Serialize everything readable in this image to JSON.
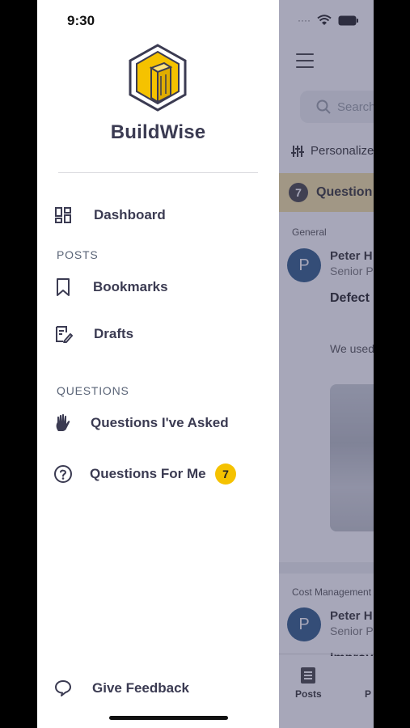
{
  "status_bar": {
    "time": "9:30"
  },
  "brand": {
    "name": "BuildWise",
    "logo_icon": "buildwise-hexagon-logo"
  },
  "drawer": {
    "dashboard": {
      "label": "Dashboard",
      "icon": "dashboard-icon"
    },
    "posts_section": "POSTS",
    "bookmarks": {
      "label": "Bookmarks",
      "icon": "bookmark-icon"
    },
    "drafts": {
      "label": "Drafts",
      "icon": "drafts-icon"
    },
    "questions_section": "QUESTIONS",
    "questions_asked": {
      "label": "Questions I've Asked",
      "icon": "raised-hand-icon"
    },
    "questions_for_me": {
      "label": "Questions For Me",
      "icon": "question-circle-icon",
      "badge": "7"
    },
    "feedback": {
      "label": "Give Feedback",
      "icon": "chat-bubble-icon"
    }
  },
  "background": {
    "search_placeholder": "Search",
    "personalize_label": "Personalize",
    "questions_banner": {
      "count": "7",
      "label": "Question"
    },
    "section_general": "General",
    "post1": {
      "avatar": "P",
      "name": "Peter H",
      "role": "Senior P",
      "title": "Defect project",
      "text": "We used project"
    },
    "section_cost": "Cost Management",
    "post2": {
      "avatar": "P",
      "name": "Peter H",
      "role": "Senior P",
      "title": "Improv"
    },
    "tab_posts": "Posts",
    "tab_partial": "P"
  },
  "colors": {
    "accent": "#f5c200",
    "brand_text": "#3b3b52",
    "overlay": "#3c3c64"
  }
}
